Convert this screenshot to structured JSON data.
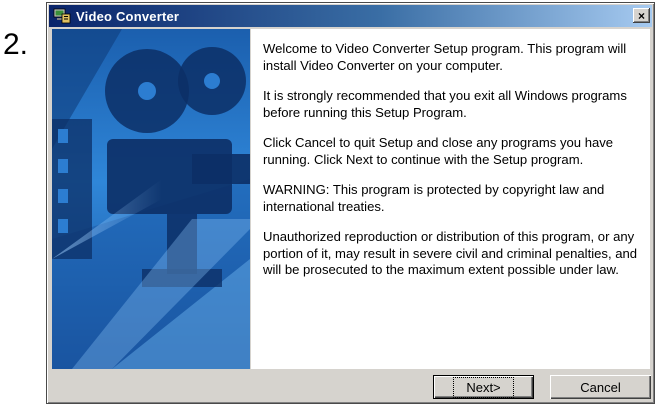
{
  "step_number": "2.",
  "window": {
    "title": "Video Converter",
    "close_label": "×"
  },
  "content": {
    "paragraphs": [
      "Welcome to Video Converter Setup program. This program will install Video Converter on your computer.",
      "It is strongly recommended that you exit all Windows programs before running this Setup Program.",
      "Click Cancel to quit Setup and close any programs you have running.  Click Next to continue with the Setup program.",
      "WARNING: This program is protected by copyright law and international treaties.",
      "Unauthorized reproduction or distribution of this program, or any portion of it, may result in severe civil and criminal penalties, and will be prosecuted to the maximum extent possible under law."
    ]
  },
  "buttons": {
    "next_label": "Next>",
    "cancel_label": "Cancel"
  },
  "icons": {
    "app": "installer-computer-icon",
    "close": "close-icon",
    "side_art": "film-projector-illustration"
  },
  "colors": {
    "title_bar_start": "#0a246a",
    "title_bar_end": "#a6caf0",
    "dialog_face": "#d6d3ce",
    "art_blue": "#2c7dd1"
  }
}
